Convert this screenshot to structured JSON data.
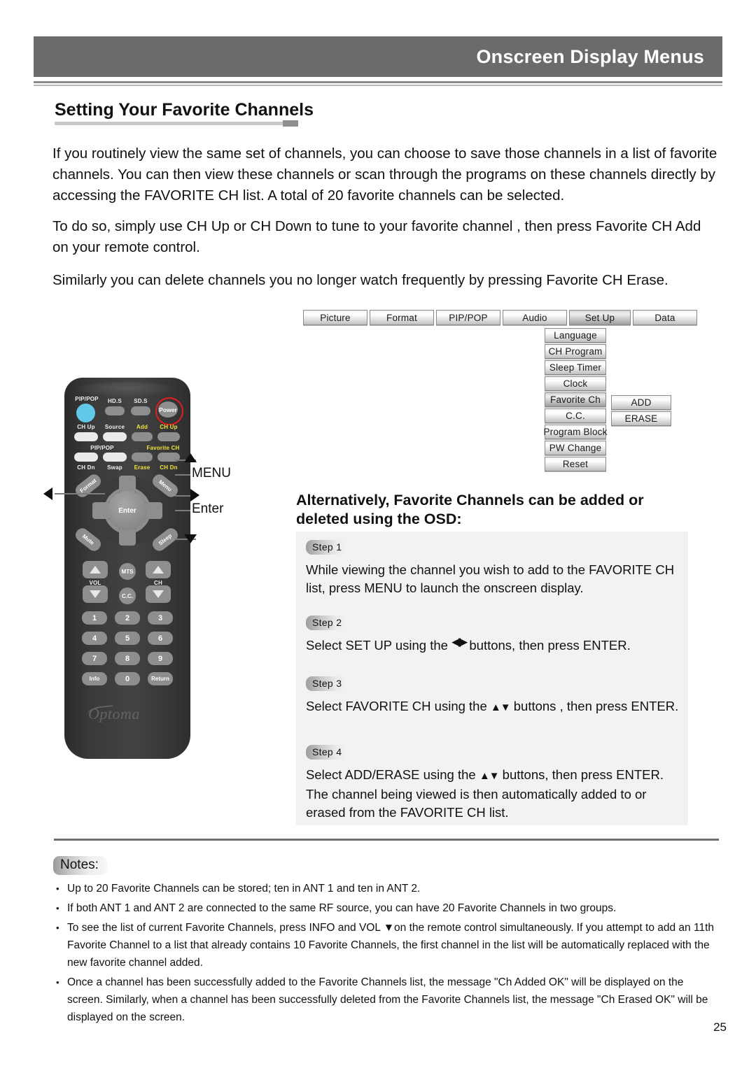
{
  "header": {
    "title": "Onscreen Display Menus"
  },
  "section": {
    "heading": "Setting Your Favorite Channels"
  },
  "body": {
    "p1": "If you routinely view the same set of channels, you can choose to save those channels in a list of favorite channels. You can then view these channels or scan through the programs on these channels directly by accessing the FAVORITE CH list. A total of 20 favorite channels can be selected.",
    "p2": "To do so, simply use CH Up or CH Down to tune to your favorite channel , then press Favorite CH Add on your remote control.",
    "p3": "Similarly you can delete channels you no longer watch frequently by pressing Favorite CH Erase."
  },
  "osd": {
    "tabs": [
      {
        "label": "Picture",
        "selected": false
      },
      {
        "label": "Format",
        "selected": false
      },
      {
        "label": "PIP/POP",
        "selected": false
      },
      {
        "label": "Audio",
        "selected": false
      },
      {
        "label": "Set Up",
        "selected": true
      },
      {
        "label": "Data",
        "selected": false
      }
    ],
    "setup_items": [
      {
        "label": "Language",
        "selected": false
      },
      {
        "label": "CH Program",
        "selected": false
      },
      {
        "label": "Sleep Timer",
        "selected": false
      },
      {
        "label": "Clock",
        "selected": false
      },
      {
        "label": "Favorite Ch",
        "selected": true
      },
      {
        "label": "C.C.",
        "selected": false
      },
      {
        "label": "Program Block",
        "selected": false
      },
      {
        "label": "PW Change",
        "selected": false
      },
      {
        "label": "Reset",
        "selected": false
      }
    ],
    "favorite_items": [
      {
        "label": "ADD"
      },
      {
        "label": "ERASE"
      }
    ]
  },
  "remote": {
    "labels": {
      "pippop_top": "PIP/POP",
      "hds": "HD.S",
      "sds": "SD.S",
      "power": "Power",
      "ch_up_left": "CH Up",
      "source": "Source",
      "add": "Add",
      "ch_up_right": "CH Up",
      "pippop_mid": "PIP/POP",
      "favorite_ch": "Favorite CH",
      "ch_dn_left": "CH Dn",
      "swap": "Swap",
      "erase": "Erase",
      "ch_dn_right": "CH Dn",
      "format": "Format",
      "menu": "Menu",
      "mute": "Mute",
      "sleep": "Sleep",
      "enter": "Enter",
      "vol": "VOL",
      "ch": "CH",
      "mts": "MTS",
      "cc": "C.C.",
      "info": "Info",
      "zero": "0",
      "return": "Return",
      "keys": [
        "1",
        "2",
        "3",
        "4",
        "5",
        "6",
        "7",
        "8",
        "9"
      ],
      "brand": "Optoma"
    },
    "callouts": {
      "menu": "MENU",
      "enter": "Enter"
    },
    "colors": {
      "body": "#3a3a3a",
      "key": "#8e8e8e",
      "key_light": "#eaeaea",
      "key_blue": "#62c8e8",
      "power_ring": "#e02020",
      "label_yellow": "#f2e33a"
    }
  },
  "alternatively": {
    "heading": "Alternatively, Favorite Channels can be added or deleted using the OSD:"
  },
  "steps": [
    {
      "pill": "Step 1",
      "text": "While viewing the channel you wish to add to the FAVORITE CH list, press MENU to launch the onscreen display."
    },
    {
      "pill": "Step 2",
      "text_before": "Select SET UP using the",
      "arrows": "◀▶",
      "text_after": "buttons, then press ENTER."
    },
    {
      "pill": "Step 3",
      "text_before": "Select FAVORITE CH using the",
      "arrows": "▲▼",
      "text_after": "buttons , then press ENTER."
    },
    {
      "pill": "Step 4",
      "text_before": "Select ADD/ERASE using the",
      "arrows": "▲▼",
      "text_after": "buttons, then press ENTER. The channel being viewed is then automatically added to or erased from the FAVORITE CH list."
    }
  ],
  "notes": {
    "label": "Notes:",
    "items": [
      "Up to 20 Favorite Channels can be stored; ten in ANT 1 and ten in ANT 2.",
      "If both ANT 1 and ANT 2 are connected to the same RF source, you can have 20 Favorite Channels in two groups.",
      "To see the list of current Favorite Channels, press INFO and VOL ▼on the remote control simultaneously. If you attempt to add an 11th Favorite Channel to a list that already contains 10 Favorite Channels, the first channel in the list will be automatically replaced with the new favorite channel added.",
      "Once a channel has been successfully added to the Favorite Channels list, the message \"Ch Added OK\" will be displayed on the screen. Similarly, when a channel has been successfully deleted from the Favorite Channels list, the message \"Ch Erased OK\" will be displayed on the screen."
    ]
  },
  "page_number": "25"
}
